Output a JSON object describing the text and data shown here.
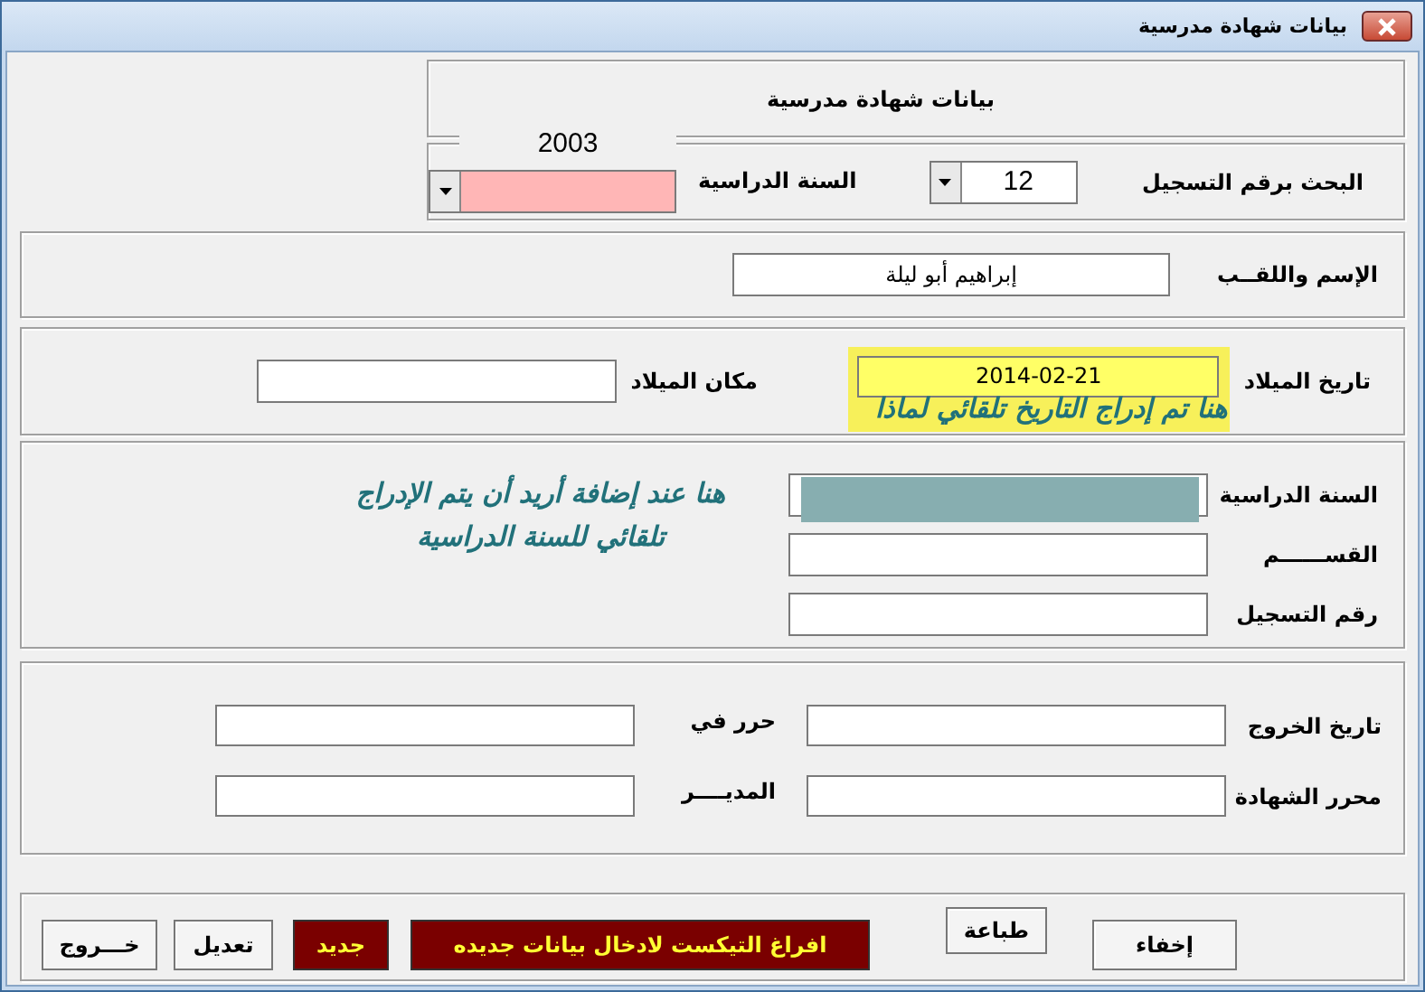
{
  "window": {
    "title": "بيانات شهادة مدرسية"
  },
  "header": {
    "title": "بيانات شهادة مدرسية"
  },
  "search": {
    "label": "البحث برقم التسجيل",
    "value": "12"
  },
  "year_select": {
    "label": "السنة الدراسية",
    "caption": "2003"
  },
  "name": {
    "label": "الإسم واللقــب",
    "value": "إبراهيم أبو ليلة"
  },
  "birth": {
    "date_label": "تاريخ الميلاد",
    "date_value": "2014-02-21",
    "highlighted": true,
    "note": "هنا تم إدراج التاريخ تلقائي لماذا",
    "place_label": "مكان الميلاد"
  },
  "study": {
    "fields": [
      {
        "label": "السنة الدراسية",
        "selected": true
      },
      {
        "label": "القســــــم",
        "selected": false
      },
      {
        "label": "رقم التسجيل",
        "selected": false
      }
    ],
    "note": "هنا عند إضافة أريد أن يتم الإدراج تلقائي للسنة الدراسية"
  },
  "certificate": {
    "fields": [
      {
        "label": "تاريخ الخروج"
      },
      {
        "label": "حرر في"
      },
      {
        "label": "محرر الشهادة"
      },
      {
        "label": "المديــــر"
      }
    ]
  },
  "buttons": [
    {
      "label": "إخفاء",
      "kind": "plain"
    },
    {
      "label": "طباعة",
      "kind": "plain"
    },
    {
      "label": "افراغ التيكست لادخال بيانات جديده",
      "kind": "dark"
    },
    {
      "label": "جديد",
      "kind": "dark"
    },
    {
      "label": "تعديل",
      "kind": "plain"
    },
    {
      "label": "خـــروج",
      "kind": "plain"
    }
  ]
}
